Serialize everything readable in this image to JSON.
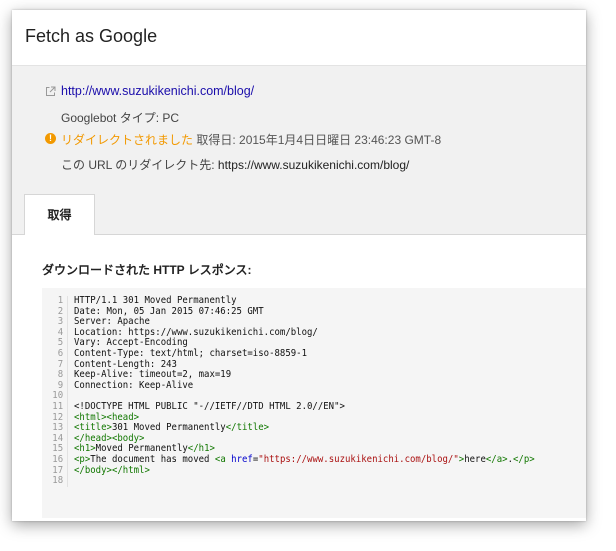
{
  "header": {
    "title": "Fetch as Google"
  },
  "fetch_info": {
    "url": "http://www.suzukikenichi.com/blog/",
    "googlebot_type": "Googlebot タイプ: PC",
    "status": "リダイレクトされました",
    "fetched_at": "取得日: 2015年1月4日日曜日 23:46:23 GMT-8",
    "redirect_label": "この URL のリダイレクト先:",
    "redirect_url": "https://www.suzukikenichi.com/blog/"
  },
  "tabs": [
    {
      "label": "取得",
      "active": true
    }
  ],
  "response": {
    "heading": "ダウンロードされた HTTP レスポンス:",
    "lines": [
      "HTTP/1.1 301 Moved Permanently",
      "Date: Mon, 05 Jan 2015 07:46:25 GMT",
      "Server: Apache",
      "Location: https://www.suzukikenichi.com/blog/",
      "Vary: Accept-Encoding",
      "Content-Type: text/html; charset=iso-8859-1",
      "Content-Length: 243",
      "Keep-Alive: timeout=2, max=19",
      "Connection: Keep-Alive",
      "",
      "<!DOCTYPE HTML PUBLIC \"-//IETF//DTD HTML 2.0//EN\">",
      "<html><head>",
      "<title>301 Moved Permanently</title>",
      "</head><body>",
      "<h1>Moved Permanently</h1>",
      "<p>The document has moved <a href=\"https://www.suzukikenichi.com/blog/\">here</a>.</p>",
      "</body></html>",
      ""
    ]
  },
  "colors": {
    "link": "#1a0dab",
    "warning": "#f29900",
    "tag": "#117700",
    "attr": "#0000cc",
    "string": "#aa1111"
  },
  "icons": {
    "url": "external-link-icon",
    "status": "warning-icon"
  }
}
